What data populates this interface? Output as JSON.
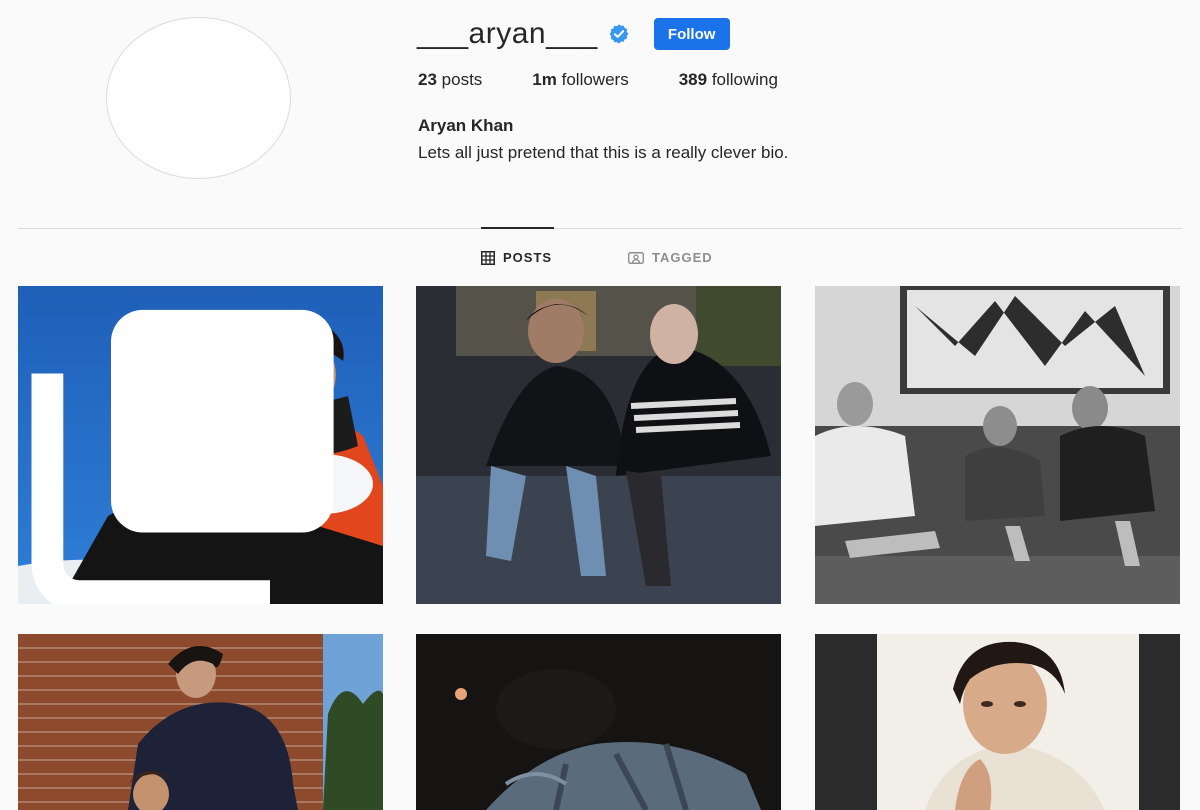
{
  "profile": {
    "username": "___aryan___",
    "verified": true,
    "follow_label": "Follow",
    "posts_count": "23",
    "posts_label": "posts",
    "followers_count": "1m",
    "followers_label": "followers",
    "following_count": "389",
    "following_label": "following",
    "full_name": "Aryan Khan",
    "bio": "Lets all just pretend that this is a really clever bio."
  },
  "tabs": [
    {
      "label": "POSTS",
      "icon": "grid-icon",
      "active": true
    },
    {
      "label": "TAGGED",
      "icon": "tagged-icon",
      "active": false
    }
  ],
  "colors": {
    "accent": "#1a73e8",
    "verified_badge": "#3897f0",
    "background": "#fafafa"
  },
  "posts": [
    {
      "description": "boy in orange jacket holding snowball against blue sky",
      "multi": true
    },
    {
      "description": "two young men in black hoodies sitting on couch"
    },
    {
      "description": "black and white photo of three young men on leather sofa"
    },
    {
      "description": "young man by brick wall with child"
    },
    {
      "description": "dark photo with denim jacket"
    },
    {
      "description": "portrait of young man with hand near chin"
    }
  ]
}
